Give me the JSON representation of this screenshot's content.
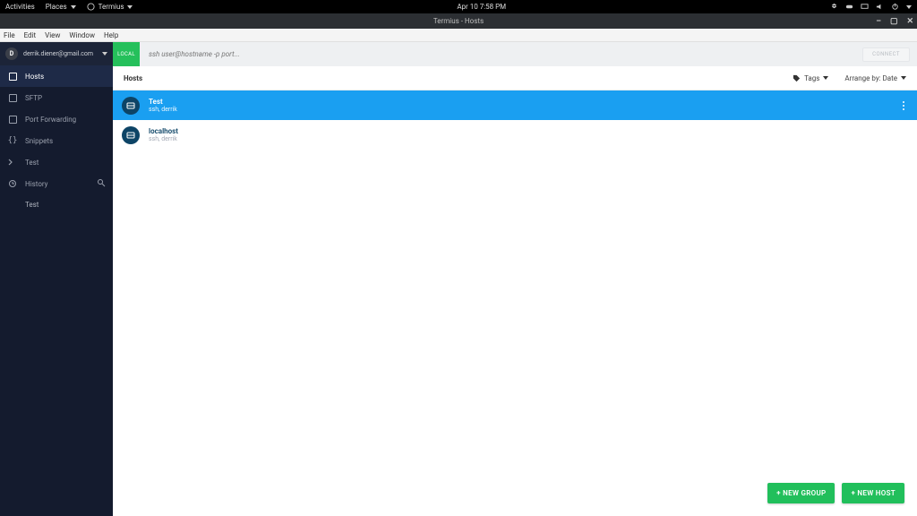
{
  "gnome": {
    "activities": "Activities",
    "places": "Places",
    "app": "Termius",
    "clock": "Apr 10  7:58 PM"
  },
  "window": {
    "title": "Termius - Hosts"
  },
  "menubar": {
    "file": "File",
    "edit": "Edit",
    "view": "View",
    "window": "Window",
    "help": "Help"
  },
  "account": {
    "initial": "D",
    "email": "derrik.diener@gmail.com"
  },
  "sidebar": {
    "hosts": "Hosts",
    "sftp": "SFTP",
    "portfwd": "Port Forwarding",
    "snippets": "Snippets",
    "test": "Test",
    "history": "History",
    "history_sub": "Test"
  },
  "quickbar": {
    "local": "LOCAL",
    "placeholder": "ssh user@hostname -p port...",
    "connect": "CONNECT"
  },
  "listheader": {
    "heading": "Hosts",
    "tags": "Tags",
    "arrange": "Arrange by: Date"
  },
  "hosts": [
    {
      "name": "Test",
      "sub": "ssh, derrik"
    },
    {
      "name": "localhost",
      "sub": "ssh, derrik"
    }
  ],
  "fab": {
    "group": "+ NEW GROUP",
    "host": "+ NEW HOST"
  }
}
